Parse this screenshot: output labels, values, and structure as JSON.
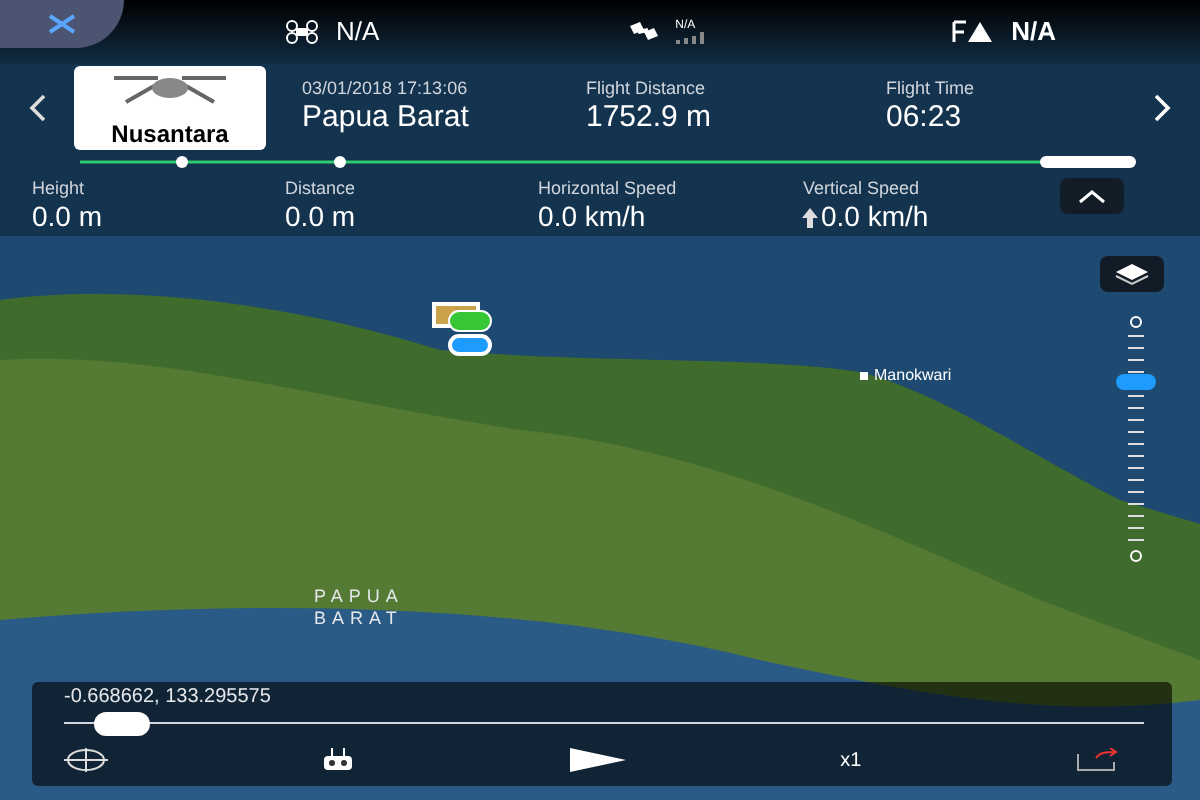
{
  "status": [
    {
      "kind": "aircraft",
      "value": "N/A"
    },
    {
      "kind": "satellite",
      "value": "N/A"
    },
    {
      "kind": "link",
      "value": "N/A"
    }
  ],
  "flight": {
    "thumbnail_label": "Nusantara",
    "datetime": "03/01/2018 17:13:06",
    "location": "Papua Barat",
    "distance_label": "Flight Distance",
    "distance": "1752.9 m",
    "time_label": "Flight Time",
    "time": "06:23"
  },
  "telemetry": [
    {
      "kind": "plain",
      "label": "Height",
      "value": "0.0 m"
    },
    {
      "kind": "plain",
      "label": "Distance",
      "value": "0.0 m"
    },
    {
      "kind": "plain",
      "label": "Horizontal Speed",
      "value": "0.0 km/h"
    },
    {
      "kind": "vertical",
      "label": "Vertical Speed",
      "value": "0.0 km/h"
    }
  ],
  "map": {
    "city_label": "Manokwari",
    "region_label": [
      "PAPUA",
      "BARAT"
    ]
  },
  "zoom_slider": {
    "level": 0.75
  },
  "playback": {
    "coordinates": "-0.668662, 133.295575",
    "level": 0.03,
    "speed": "x1"
  }
}
